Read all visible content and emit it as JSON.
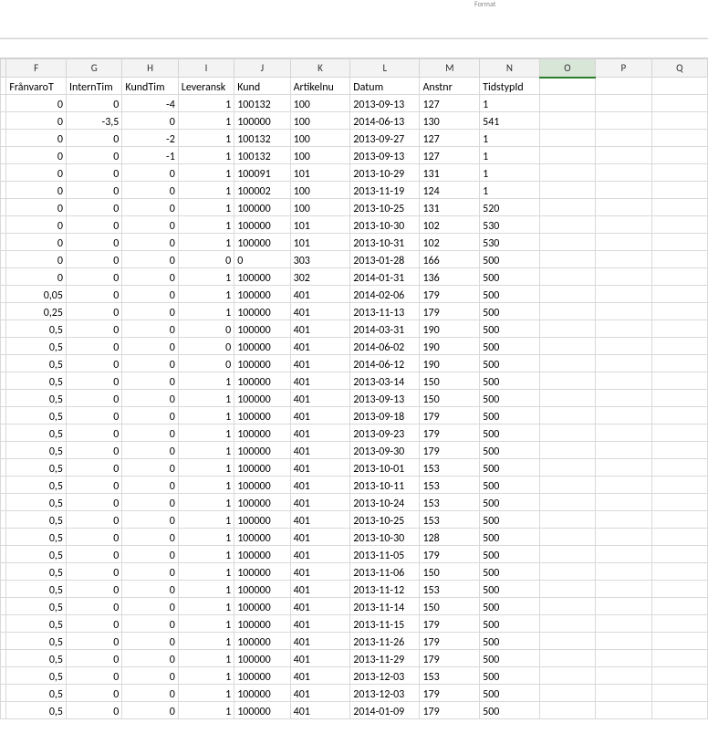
{
  "top": {
    "format_label": "Format"
  },
  "columns": [
    "F",
    "G",
    "H",
    "I",
    "J",
    "K",
    "L",
    "M",
    "N",
    "O",
    "P",
    "Q"
  ],
  "selected_column": "O",
  "headers": {
    "F": "FrånvaroT",
    "G": "InternTim",
    "H": "KundTim",
    "I": "Leveransk",
    "J": "Kund",
    "K": "Artikelnum",
    "L": "Datum",
    "M": "Anstnr",
    "N": "TidstypId",
    "O": "",
    "P": "",
    "Q": ""
  },
  "header_visible": {
    "I": "Leveransk",
    "K": "Artikelnu"
  },
  "rows": [
    {
      "F": "0",
      "G": "0",
      "H": "-4",
      "I": "1",
      "J": "100132",
      "K": "100",
      "L": "2013-09-13",
      "M": "127",
      "N": "1"
    },
    {
      "F": "0",
      "G": "-3,5",
      "H": "0",
      "I": "1",
      "J": "100000",
      "K": "100",
      "L": "2014-06-13",
      "M": "130",
      "N": "541"
    },
    {
      "F": "0",
      "G": "0",
      "H": "-2",
      "I": "1",
      "J": "100132",
      "K": "100",
      "L": "2013-09-27",
      "M": "127",
      "N": "1"
    },
    {
      "F": "0",
      "G": "0",
      "H": "-1",
      "I": "1",
      "J": "100132",
      "K": "100",
      "L": "2013-09-13",
      "M": "127",
      "N": "1"
    },
    {
      "F": "0",
      "G": "0",
      "H": "0",
      "I": "1",
      "J": "100091",
      "K": "101",
      "L": "2013-10-29",
      "M": "131",
      "N": "1"
    },
    {
      "F": "0",
      "G": "0",
      "H": "0",
      "I": "1",
      "J": "100002",
      "K": "100",
      "L": "2013-11-19",
      "M": "124",
      "N": "1"
    },
    {
      "F": "0",
      "G": "0",
      "H": "0",
      "I": "1",
      "J": "100000",
      "K": "100",
      "L": "2013-10-25",
      "M": "131",
      "N": "520"
    },
    {
      "F": "0",
      "G": "0",
      "H": "0",
      "I": "1",
      "J": "100000",
      "K": "101",
      "L": "2013-10-30",
      "M": "102",
      "N": "530"
    },
    {
      "F": "0",
      "G": "0",
      "H": "0",
      "I": "1",
      "J": "100000",
      "K": "101",
      "L": "2013-10-31",
      "M": "102",
      "N": "530"
    },
    {
      "F": "0",
      "G": "0",
      "H": "0",
      "I": "0",
      "J": "0",
      "K": "303",
      "L": "2013-01-28",
      "M": "166",
      "N": "500"
    },
    {
      "F": "0",
      "G": "0",
      "H": "0",
      "I": "1",
      "J": "100000",
      "K": "302",
      "L": "2014-01-31",
      "M": "136",
      "N": "500"
    },
    {
      "F": "0,05",
      "G": "0",
      "H": "0",
      "I": "1",
      "J": "100000",
      "K": "401",
      "L": "2014-02-06",
      "M": "179",
      "N": "500"
    },
    {
      "F": "0,25",
      "G": "0",
      "H": "0",
      "I": "1",
      "J": "100000",
      "K": "401",
      "L": "2013-11-13",
      "M": "179",
      "N": "500"
    },
    {
      "F": "0,5",
      "G": "0",
      "H": "0",
      "I": "0",
      "J": "100000",
      "K": "401",
      "L": "2014-03-31",
      "M": "190",
      "N": "500"
    },
    {
      "F": "0,5",
      "G": "0",
      "H": "0",
      "I": "0",
      "J": "100000",
      "K": "401",
      "L": "2014-06-02",
      "M": "190",
      "N": "500"
    },
    {
      "F": "0,5",
      "G": "0",
      "H": "0",
      "I": "0",
      "J": "100000",
      "K": "401",
      "L": "2014-06-12",
      "M": "190",
      "N": "500"
    },
    {
      "F": "0,5",
      "G": "0",
      "H": "0",
      "I": "1",
      "J": "100000",
      "K": "401",
      "L": "2013-03-14",
      "M": "150",
      "N": "500"
    },
    {
      "F": "0,5",
      "G": "0",
      "H": "0",
      "I": "1",
      "J": "100000",
      "K": "401",
      "L": "2013-09-13",
      "M": "150",
      "N": "500"
    },
    {
      "F": "0,5",
      "G": "0",
      "H": "0",
      "I": "1",
      "J": "100000",
      "K": "401",
      "L": "2013-09-18",
      "M": "179",
      "N": "500"
    },
    {
      "F": "0,5",
      "G": "0",
      "H": "0",
      "I": "1",
      "J": "100000",
      "K": "401",
      "L": "2013-09-23",
      "M": "179",
      "N": "500"
    },
    {
      "F": "0,5",
      "G": "0",
      "H": "0",
      "I": "1",
      "J": "100000",
      "K": "401",
      "L": "2013-09-30",
      "M": "179",
      "N": "500"
    },
    {
      "F": "0,5",
      "G": "0",
      "H": "0",
      "I": "1",
      "J": "100000",
      "K": "401",
      "L": "2013-10-01",
      "M": "153",
      "N": "500"
    },
    {
      "F": "0,5",
      "G": "0",
      "H": "0",
      "I": "1",
      "J": "100000",
      "K": "401",
      "L": "2013-10-11",
      "M": "153",
      "N": "500"
    },
    {
      "F": "0,5",
      "G": "0",
      "H": "0",
      "I": "1",
      "J": "100000",
      "K": "401",
      "L": "2013-10-24",
      "M": "153",
      "N": "500"
    },
    {
      "F": "0,5",
      "G": "0",
      "H": "0",
      "I": "1",
      "J": "100000",
      "K": "401",
      "L": "2013-10-25",
      "M": "153",
      "N": "500"
    },
    {
      "F": "0,5",
      "G": "0",
      "H": "0",
      "I": "1",
      "J": "100000",
      "K": "401",
      "L": "2013-10-30",
      "M": "128",
      "N": "500"
    },
    {
      "F": "0,5",
      "G": "0",
      "H": "0",
      "I": "1",
      "J": "100000",
      "K": "401",
      "L": "2013-11-05",
      "M": "179",
      "N": "500"
    },
    {
      "F": "0,5",
      "G": "0",
      "H": "0",
      "I": "1",
      "J": "100000",
      "K": "401",
      "L": "2013-11-06",
      "M": "150",
      "N": "500"
    },
    {
      "F": "0,5",
      "G": "0",
      "H": "0",
      "I": "1",
      "J": "100000",
      "K": "401",
      "L": "2013-11-12",
      "M": "153",
      "N": "500"
    },
    {
      "F": "0,5",
      "G": "0",
      "H": "0",
      "I": "1",
      "J": "100000",
      "K": "401",
      "L": "2013-11-14",
      "M": "150",
      "N": "500"
    },
    {
      "F": "0,5",
      "G": "0",
      "H": "0",
      "I": "1",
      "J": "100000",
      "K": "401",
      "L": "2013-11-15",
      "M": "179",
      "N": "500"
    },
    {
      "F": "0,5",
      "G": "0",
      "H": "0",
      "I": "1",
      "J": "100000",
      "K": "401",
      "L": "2013-11-26",
      "M": "179",
      "N": "500"
    },
    {
      "F": "0,5",
      "G": "0",
      "H": "0",
      "I": "1",
      "J": "100000",
      "K": "401",
      "L": "2013-11-29",
      "M": "179",
      "N": "500"
    },
    {
      "F": "0,5",
      "G": "0",
      "H": "0",
      "I": "1",
      "J": "100000",
      "K": "401",
      "L": "2013-12-03",
      "M": "153",
      "N": "500"
    },
    {
      "F": "0,5",
      "G": "0",
      "H": "0",
      "I": "1",
      "J": "100000",
      "K": "401",
      "L": "2013-12-03",
      "M": "179",
      "N": "500"
    },
    {
      "F": "0,5",
      "G": "0",
      "H": "0",
      "I": "1",
      "J": "100000",
      "K": "401",
      "L": "2014-01-09",
      "M": "179",
      "N": "500"
    }
  ]
}
